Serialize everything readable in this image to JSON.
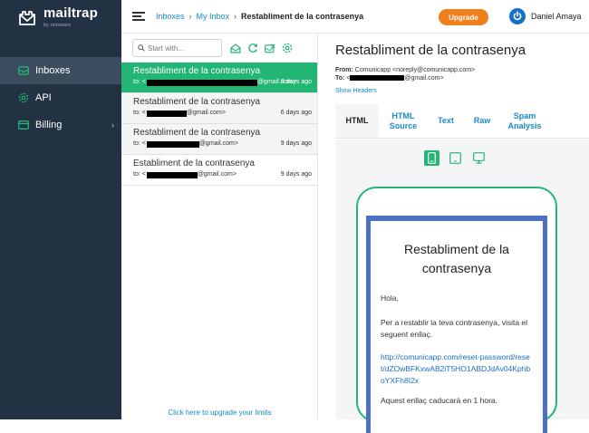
{
  "brand": {
    "name": "mailtrap",
    "sub": "by railsware"
  },
  "sidebar": {
    "items": [
      {
        "label": "Inboxes",
        "icon": "inbox-icon"
      },
      {
        "label": "API",
        "icon": "gear-icon"
      },
      {
        "label": "Billing",
        "icon": "card-icon"
      }
    ]
  },
  "header": {
    "breadcrumb": [
      "Inboxes",
      "My Inbox",
      "Restabliment de la contrasenya"
    ],
    "upgrade_label": "Upgrade",
    "user_name": "Daniel Amaya"
  },
  "list": {
    "search_placeholder": "Start with...",
    "messages": [
      {
        "subject": "Restabliment de la contrasenya",
        "to_prefix": "to: <",
        "to_suffix": "@gmail.com>",
        "date": "3 days ago"
      },
      {
        "subject": "Restabliment de la contrasenya",
        "to_prefix": "to: <",
        "to_suffix": "@gmail.com>",
        "date": "6 days ago"
      },
      {
        "subject": "Restabliment de la contrasenya",
        "to_prefix": "to: <",
        "to_suffix": "@gmail.com>",
        "date": "9 days ago"
      },
      {
        "subject": "Establiment de la contrasenya",
        "to_prefix": "to: <",
        "to_suffix": "@gmail.com>",
        "date": "9 days ago"
      }
    ],
    "upgrade_text": "Click here to upgrade your limits"
  },
  "detail": {
    "title": "Restabliment de la contrasenya",
    "from_label": "From:",
    "from_value": "Comunicapp <noreply@comunicapp.com>",
    "to_label": "To:",
    "to_prefix": "<",
    "to_suffix": "@gmail.com>",
    "show_headers": "Show Headers",
    "tabs": [
      "HTML",
      "HTML Source",
      "Text",
      "Raw",
      "Spam Analysis"
    ]
  },
  "email": {
    "heading": "Restabliment de la contrasenya",
    "greeting": "Hola,",
    "body": "Per a restablir la teva contrasenya, visita el seguent enllaç.",
    "link": "http://comunicapp.com/reset-password/reset/dZOwBFKxwAB2iT5HO1ABDJdAv04KphboYXFh8I2x",
    "expiry": "Aquest enllaç caducarà en 1 hora."
  },
  "colors": {
    "sidebar": "#233242",
    "accent": "#22b573",
    "upgrade": "#f07f1d",
    "link": "#1a8ac7"
  }
}
